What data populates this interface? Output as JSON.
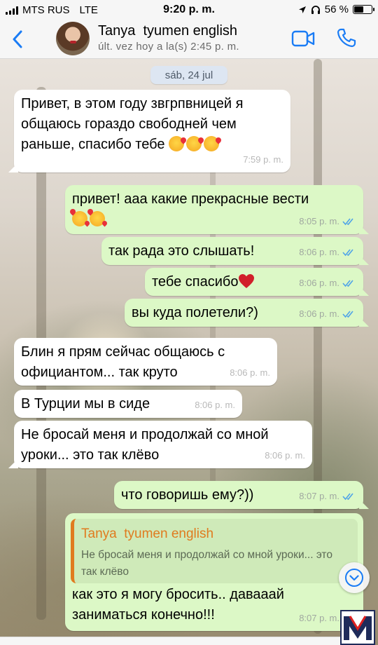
{
  "status_bar": {
    "carrier": "MTS RUS",
    "network": "LTE",
    "time": "9:20 p. m.",
    "battery": "56 %",
    "battery_level": 0.56
  },
  "header": {
    "contact_name": "Tanya  tyumen english",
    "last_seen": "últ. vez hoy a la(s) 2:45 p. m.",
    "icons": [
      "chevron-left-icon",
      "video-call-icon",
      "phone-icon"
    ],
    "accent_color": "#1a7cf5"
  },
  "chat": {
    "date_chip": "sáb, 24 jul",
    "messages": [
      {
        "direction": "in",
        "text": "Привет, в этом году звгрпвницей я общаюсь гораздо свободней чем раньше, спасибо тебе",
        "emojis": [
          "kissing-face",
          "kissing-face",
          "kissing-face"
        ],
        "time": "7:59 p. m."
      },
      {
        "direction": "out",
        "text": "привет! ааа какие прекрасные вести",
        "emojis": [
          "smiling-face-with-hearts",
          "smiling-face-with-hearts"
        ],
        "time": "8:05 p. m.",
        "status": "read"
      },
      {
        "direction": "out",
        "text": "так рада это слышать!",
        "time": "8:06 p. m.",
        "status": "read"
      },
      {
        "direction": "out",
        "text": "тебе спасибо",
        "emojis": [
          "red-heart"
        ],
        "time": "8:06 p. m.",
        "status": "read"
      },
      {
        "direction": "out",
        "text": "вы куда полетели?)",
        "time": "8:06 p. m.",
        "status": "read"
      },
      {
        "direction": "in",
        "text": "Блин я прям сейчас общаюсь с официантом... так круто",
        "time": "8:06 p. m."
      },
      {
        "direction": "in",
        "text": "В Турции мы в сиде",
        "time": "8:06 p. m."
      },
      {
        "direction": "in",
        "text": "Не бросай меня и продолжай со мной уроки... это так клёво",
        "time": "8:06 p. m."
      },
      {
        "direction": "out",
        "text": "что говоришь ему?))",
        "time": "8:07 p. m.",
        "status": "read"
      },
      {
        "direction": "out",
        "text": "как это я могу бросить.. давааай заниматься конечно!!!",
        "time": "8:07 p. m.",
        "status": "read",
        "quote": {
          "author": "Tanya  tyumen english",
          "text": "Не бросай меня и продолжай со мной уроки... это так клёво"
        }
      }
    ]
  },
  "colors": {
    "outgoing_bubble": "#dcf8c6",
    "incoming_bubble": "#ffffff",
    "read_ticks": "#4fa3e8",
    "quote_author": "#e07b1f"
  },
  "logo": {
    "letter": "M"
  }
}
